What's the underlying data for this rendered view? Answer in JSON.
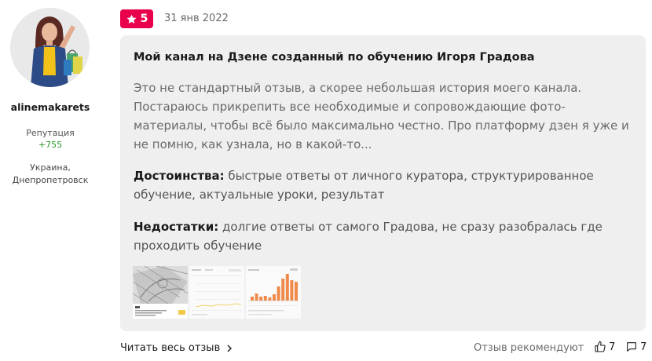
{
  "author": {
    "username": "alinemakarets",
    "reputation_label": "Репутация",
    "reputation_value": "+755",
    "location_line1": "Украина,",
    "location_line2": "Днепропетровск"
  },
  "review": {
    "rating": "5",
    "date": "31 янв 2022",
    "title": "Мой канал на Дзене созданный по обучению Игоря Градова",
    "body": "Это не стандартный отзыв, а скорее небольшая история моего канала. Постараюсь прикрепить все необходимые и сопровождающие фото-материалы, чтобы всё было максимально честно. Про платформу дзен я уже и не помню, как узнала, но в какой-то...",
    "pros_label": "Достоинства:",
    "pros_text": " быстрые ответы от личного куратора, структурированное обучение, актуальные уроки, результат",
    "cons_label": "Недостатки:",
    "cons_text": " долгие ответы от самого Градова, не сразу разобралась где проходить обучение"
  },
  "thumbnails": {
    "chart_bar_values": [
      5,
      9,
      5,
      6,
      4,
      8,
      18,
      28,
      34,
      26,
      24
    ]
  },
  "footer": {
    "read_more": "Читать весь отзыв",
    "recommend_label": "Отзыв рекомендуют",
    "likes": "7",
    "comments": "7"
  },
  "colors": {
    "badge": "#e8004c",
    "reputation": "#2a9a2a",
    "card_bg": "#efefef",
    "chart_bars": "#f08a4b"
  }
}
